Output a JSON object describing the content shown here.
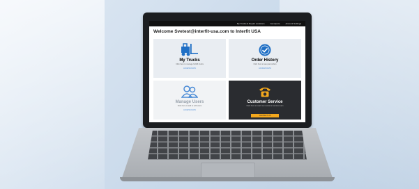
{
  "screen": {
    "topbar": {
      "items": [
        "My Trucks & Repair Locations",
        "Get Quote",
        "Account Settings"
      ]
    },
    "welcome": "Welcome Svetest@interfit-usa.com to Interfit USA",
    "tiles": [
      {
        "title": "My Trucks",
        "subtitle": "Click here to manage forklift trucks",
        "link": "ACCESS DATA",
        "icon": "forklift-icon"
      },
      {
        "title": "Order History",
        "subtitle": "Click here to see past orders",
        "link": "ACCESS DATA",
        "icon": "check-circle-icon"
      },
      {
        "title": "Manage Users",
        "subtitle": "Click here to add or edit users",
        "link": "ACCESS DATA",
        "icon": "users-icon"
      },
      {
        "title": "Customer Service",
        "subtitle": "Click here to reach our customer service team",
        "button": "CONTACT US",
        "icon": "telephone-icon"
      }
    ]
  },
  "colors": {
    "accent_blue": "#1f6fc5",
    "service_orange": "#f4a81d",
    "dark_tile": "#2a2c30"
  }
}
